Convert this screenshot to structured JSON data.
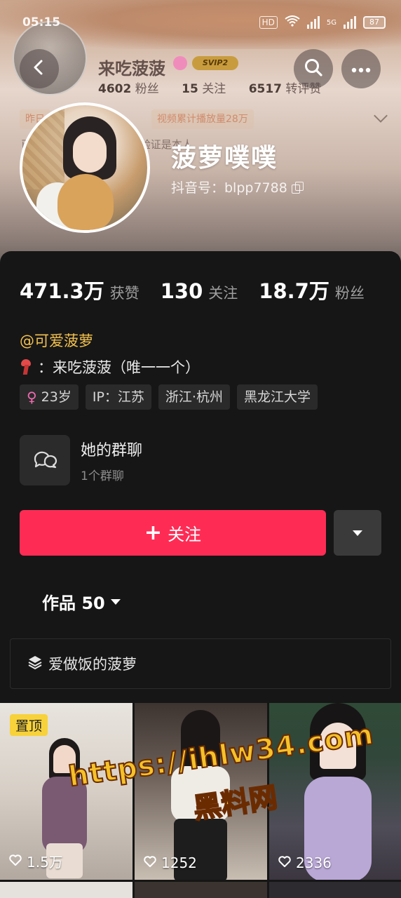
{
  "status_bar": {
    "time": "05:15",
    "hd": "HD",
    "net": "5G",
    "battery": "87"
  },
  "background_profile": {
    "name": "来吃菠菠",
    "badge": "SVIP2",
    "stats": [
      {
        "num": "4602",
        "label": "粉丝"
      },
      {
        "num": "15",
        "label": "关注"
      },
      {
        "num": "6517",
        "label": "转评赞"
      }
    ],
    "tags": [
      "昨日",
      "视频累计播放量28万"
    ],
    "note": "已      被其他人认定，可视频验证是本人"
  },
  "profile": {
    "nickname": "菠萝噗噗",
    "douyin_id": "抖音号：blpp7788"
  },
  "stats": [
    {
      "num": "471.3万",
      "label": "获赞"
    },
    {
      "num": "130",
      "label": "关注"
    },
    {
      "num": "18.7万",
      "label": "粉丝"
    }
  ],
  "at_line": "@可爱菠萝",
  "bio": "：来吃菠菠（唯一一个）",
  "tags": {
    "age": "23岁",
    "ip": "IP：江苏",
    "location": "浙江·杭州",
    "school": "黑龙江大学"
  },
  "group": {
    "title": "她的群聊",
    "sub": "1个群聊"
  },
  "follow_label": "关注",
  "works_tab": "作品 50",
  "collection_label": "爱做饭的菠萝",
  "videos": [
    {
      "pinned": "置顶",
      "likes": "1.5万"
    },
    {
      "likes": "1252"
    },
    {
      "likes": "2336"
    }
  ],
  "watermark": {
    "url": "https://ihlw34.com",
    "name": "黑料网"
  },
  "colors": {
    "accent": "#fe2c55",
    "at_color": "#f2c14e",
    "pin_badge": "#f7d23a"
  }
}
